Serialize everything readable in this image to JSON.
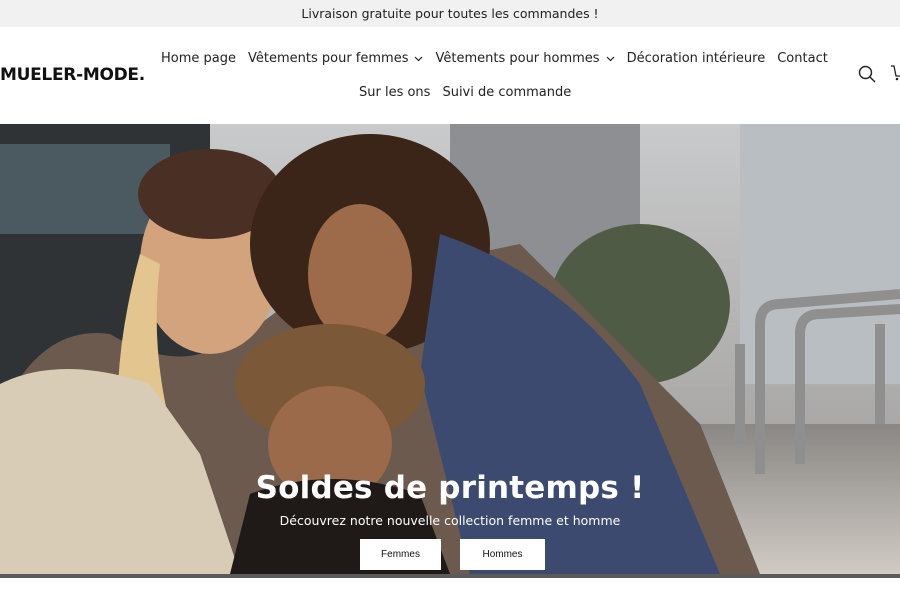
{
  "announcement": {
    "text": "Livraison gratuite pour toutes les commandes !"
  },
  "header": {
    "logo": "MUELER-MODE.",
    "nav_row1": [
      {
        "label": "Home page",
        "has_dropdown": false
      },
      {
        "label": "Vêtements pour femmes",
        "has_dropdown": true
      },
      {
        "label": "Vêtements pour hommes",
        "has_dropdown": true
      },
      {
        "label": "Décoration intérieure",
        "has_dropdown": false
      },
      {
        "label": "Contact",
        "has_dropdown": false
      }
    ],
    "nav_row2": [
      {
        "label": "Sur les ons",
        "has_dropdown": false
      },
      {
        "label": "Suivi de commande",
        "has_dropdown": false
      }
    ],
    "icons": [
      "search-icon",
      "cart-icon"
    ]
  },
  "hero": {
    "title": "Soldes de printemps !",
    "subtitle": "Découvrez notre nouvelle collection femme et homme",
    "buttons": {
      "femmes": "Femmes",
      "hommes": "Hommes"
    }
  },
  "colors": {
    "announcement_bg": "#f1f1f1",
    "text": "#111111",
    "button_bg": "#ffffff"
  }
}
